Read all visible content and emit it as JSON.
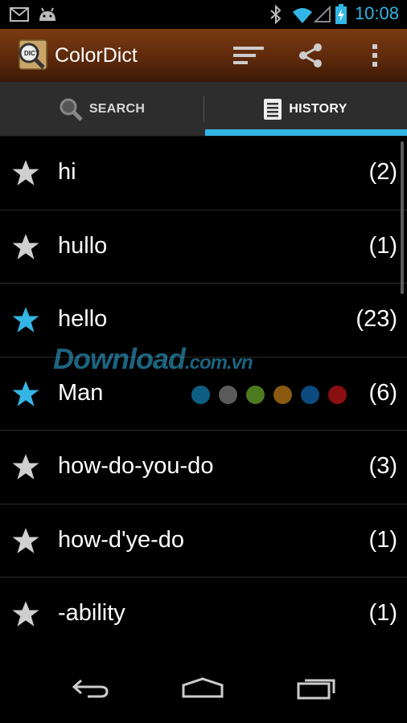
{
  "status_bar": {
    "time": "10:08",
    "icons": [
      "gmail-icon",
      "android-icon",
      "bluetooth-icon",
      "wifi-icon",
      "signal-icon",
      "battery-charging-icon"
    ]
  },
  "action_bar": {
    "title": "ColorDict",
    "logo_text": "DICT",
    "actions": [
      "sort-icon",
      "share-icon",
      "overflow-menu-icon"
    ]
  },
  "tabs": [
    {
      "label": "SEARCH",
      "icon": "search-icon",
      "selected": false
    },
    {
      "label": "HISTORY",
      "icon": "history-list-icon",
      "selected": true
    }
  ],
  "history": [
    {
      "word": "hi",
      "count": "(2)",
      "starred": false
    },
    {
      "word": "hullo",
      "count": "(1)",
      "starred": false
    },
    {
      "word": "hello",
      "count": "(23)",
      "starred": true
    },
    {
      "word": "Man",
      "count": "(6)",
      "starred": true,
      "dots": [
        "#0e5e84",
        "#5a5a5a",
        "#4b7a1f",
        "#8a5a10",
        "#0c4a80",
        "#8a0f12"
      ]
    },
    {
      "word": "how-do-you-do",
      "count": "(3)",
      "starred": false
    },
    {
      "word": "how-d'ye-do",
      "count": "(1)",
      "starred": false
    },
    {
      "word": "-ability",
      "count": "(1)",
      "starred": false
    }
  ],
  "watermark": {
    "main": "Download",
    "suffix": ".com.vn"
  },
  "colors": {
    "accent": "#33b5e5",
    "star_default": "#cfcfcf",
    "star_active": "#33b5e5",
    "action_bar": "#5e2a0b"
  },
  "nav_bar": [
    "back-icon",
    "home-icon",
    "recents-icon"
  ]
}
